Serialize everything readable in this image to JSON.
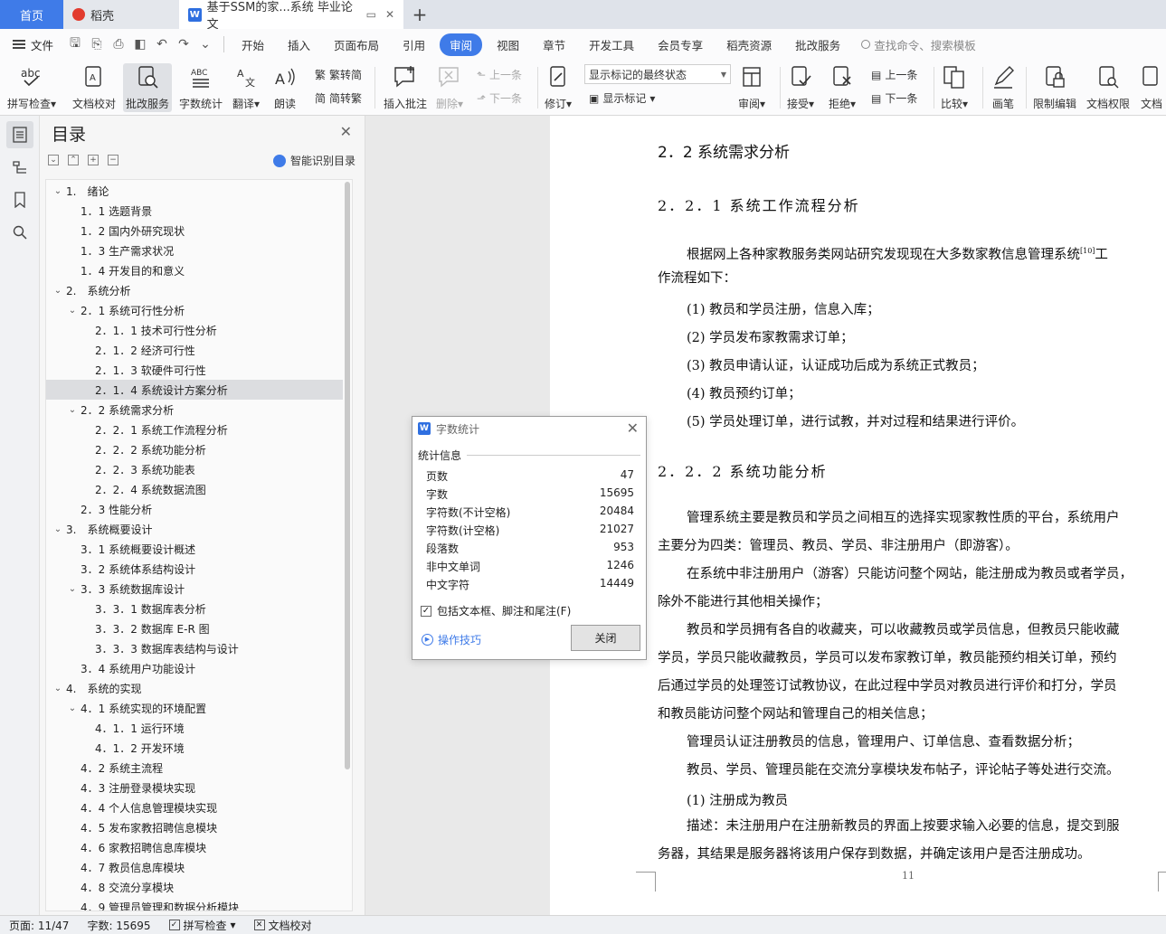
{
  "tabs": {
    "home": "首页",
    "daoke": "稻壳",
    "doc": "基于SSM的家...系统 毕业论文"
  },
  "menu": {
    "file": "文件",
    "items": [
      "开始",
      "插入",
      "页面布局",
      "引用",
      "审阅",
      "视图",
      "章节",
      "开发工具",
      "会员专享",
      "稻壳资源",
      "批改服务"
    ],
    "active_index": 4,
    "search": "查找命令、搜索模板"
  },
  "ribbon": {
    "spellcheck": "拼写检查",
    "doc_check": "文档校对",
    "correct_service": "批改服务",
    "word_count": "字数统计",
    "translate": "翻译",
    "read_aloud": "朗读",
    "trad_conv": "繁转简",
    "simp_conv": "简转繁",
    "insert_comment": "插入批注",
    "delete": "删除",
    "prev_comment": "上一条",
    "next_comment": "下一条",
    "revise": "修订",
    "markup_mode": "显示标记的最终状态",
    "show_markup": "显示标记",
    "review": "审阅",
    "accept": "接受",
    "reject": "拒绝",
    "prev_change": "上一条",
    "next_change": "下一条",
    "compare": "比较",
    "pen": "画笔",
    "restrict_edit": "限制编辑",
    "doc_perm": "文档权限",
    "doc_more": "文档"
  },
  "toc": {
    "title": "目录",
    "smart": "智能识别目录",
    "items": [
      {
        "text": "1.　绪论",
        "level": 1,
        "twisty": "v"
      },
      {
        "text": "1．1 选题背景",
        "level": 2,
        "twisty": ""
      },
      {
        "text": "1．2 国内外研究现状",
        "level": 2,
        "twisty": ""
      },
      {
        "text": "1．3 生产需求状况",
        "level": 2,
        "twisty": ""
      },
      {
        "text": "1．4 开发目的和意义",
        "level": 2,
        "twisty": ""
      },
      {
        "text": "2.　系统分析",
        "level": 1,
        "twisty": "v"
      },
      {
        "text": "2．1 系统可行性分析",
        "level": 2,
        "twisty": "v"
      },
      {
        "text": "2．1．1 技术可行性分析",
        "level": 3,
        "twisty": ""
      },
      {
        "text": "2．1．2 经济可行性",
        "level": 3,
        "twisty": ""
      },
      {
        "text": "2．1．3 软硬件可行性",
        "level": 3,
        "twisty": ""
      },
      {
        "text": "2．1．4 系统设计方案分析",
        "level": 3,
        "twisty": "",
        "selected": true
      },
      {
        "text": "2．2 系统需求分析",
        "level": 2,
        "twisty": "v"
      },
      {
        "text": "2．2．1 系统工作流程分析",
        "level": 3,
        "twisty": ""
      },
      {
        "text": "2．2．2 系统功能分析",
        "level": 3,
        "twisty": ""
      },
      {
        "text": "2．2．3 系统功能表",
        "level": 3,
        "twisty": ""
      },
      {
        "text": "2．2．4 系统数据流图",
        "level": 3,
        "twisty": ""
      },
      {
        "text": "2．3 性能分析",
        "level": 2,
        "twisty": ""
      },
      {
        "text": "3.　系统概要设计",
        "level": 1,
        "twisty": "v"
      },
      {
        "text": "3．1 系统概要设计概述",
        "level": 2,
        "twisty": ""
      },
      {
        "text": "3．2 系统体系结构设计",
        "level": 2,
        "twisty": ""
      },
      {
        "text": "3．3 系统数据库设计",
        "level": 2,
        "twisty": "v"
      },
      {
        "text": "3．3．1 数据库表分析",
        "level": 3,
        "twisty": ""
      },
      {
        "text": "3．3．2 数据库 E-R 图",
        "level": 3,
        "twisty": ""
      },
      {
        "text": "3．3．3 数据库表结构与设计",
        "level": 3,
        "twisty": ""
      },
      {
        "text": "3．4 系统用户功能设计",
        "level": 2,
        "twisty": ""
      },
      {
        "text": "4.　系统的实现",
        "level": 1,
        "twisty": "v"
      },
      {
        "text": "4．1 系统实现的环境配置",
        "level": 2,
        "twisty": "v"
      },
      {
        "text": "4．1．1 运行环境",
        "level": 3,
        "twisty": ""
      },
      {
        "text": "4．1．2 开发环境",
        "level": 3,
        "twisty": ""
      },
      {
        "text": "4．2 系统主流程",
        "level": 2,
        "twisty": ""
      },
      {
        "text": "4．3 注册登录模块实现",
        "level": 2,
        "twisty": ""
      },
      {
        "text": "4．4 个人信息管理模块实现",
        "level": 2,
        "twisty": ""
      },
      {
        "text": "4．5 发布家教招聘信息模块",
        "level": 2,
        "twisty": ""
      },
      {
        "text": "4．6 家教招聘信息库模块",
        "level": 2,
        "twisty": ""
      },
      {
        "text": "4．7 教员信息库模块",
        "level": 2,
        "twisty": ""
      },
      {
        "text": "4．8 交流分享模块",
        "level": 2,
        "twisty": ""
      },
      {
        "text": "4．9 管理员管理和数据分析模块",
        "level": 2,
        "twisty": ""
      }
    ]
  },
  "doc": {
    "h2": "2．2 系统需求分析",
    "h3a": "2．2．1 系统工作流程分析",
    "p1a": "根据网上各种家教服务类网站研究发现现在大多数家教信息管理系统",
    "p1_ref": "[10]",
    "p1_tail": "工",
    "p1b": "作流程如下：",
    "steps": [
      "(1)  教员和学员注册，信息入库；",
      "(2)  学员发布家教需求订单；",
      "(3)  教员申请认证，认证成功后成为系统正式教员；",
      "(4)  教员预约订单；",
      "(5)  学员处理订单，进行试教，并对过程和结果进行评价。"
    ],
    "h3b": "2．2．2 系统功能分析",
    "lines": [
      "管理系统主要是教员和学员之间相互的选择实现家教性质的平台，系统用户",
      "主要分为四类：管理员、教员、学员、非注册用户（即游客）。",
      "在系统中非注册用户（游客）只能访问整个网站，能注册成为教员或者学员，",
      "除外不能进行其他相关操作；",
      "教员和学员拥有各自的收藏夹，可以收藏教员或学员信息，但教员只能收藏",
      "学员，学员只能收藏教员，学员可以发布家教订单，教员能预约相关订单，预约",
      "后通过学员的处理签订试教协议，在此过程中学员对教员进行评价和打分，学员",
      "和教员能访问整个网站和管理自己的相关信息；",
      "管理员认证注册教员的信息，管理用户、订单信息、查看数据分析；",
      "教员、学员、管理员能在交流分享模块发布帖子，评论帖子等处进行交流。",
      "(1)  注册成为教员",
      "描述：未注册用户在注册新教员的界面上按要求输入必要的信息，提交到服",
      "务器，其结果是服务器将该用户保存到数据，并确定该用户是否注册成功。"
    ],
    "page_number": "11"
  },
  "dialog": {
    "title": "字数统计",
    "section": "统计信息",
    "rows": [
      {
        "label": "页数",
        "value": "47"
      },
      {
        "label": "字数",
        "value": "15695"
      },
      {
        "label": "字符数(不计空格)",
        "value": "20484"
      },
      {
        "label": "字符数(计空格)",
        "value": "21027"
      },
      {
        "label": "段落数",
        "value": "953"
      },
      {
        "label": "非中文单词",
        "value": "1246"
      },
      {
        "label": "中文字符",
        "value": "14449"
      }
    ],
    "include_label": "包括文本框、脚注和尾注(F)",
    "include_checked": true,
    "tips": "操作技巧",
    "close": "关闭"
  },
  "status": {
    "page": "页面: 11/47",
    "words": "字数: 15695",
    "spell": "拼写检查",
    "proof": "文档校对"
  }
}
